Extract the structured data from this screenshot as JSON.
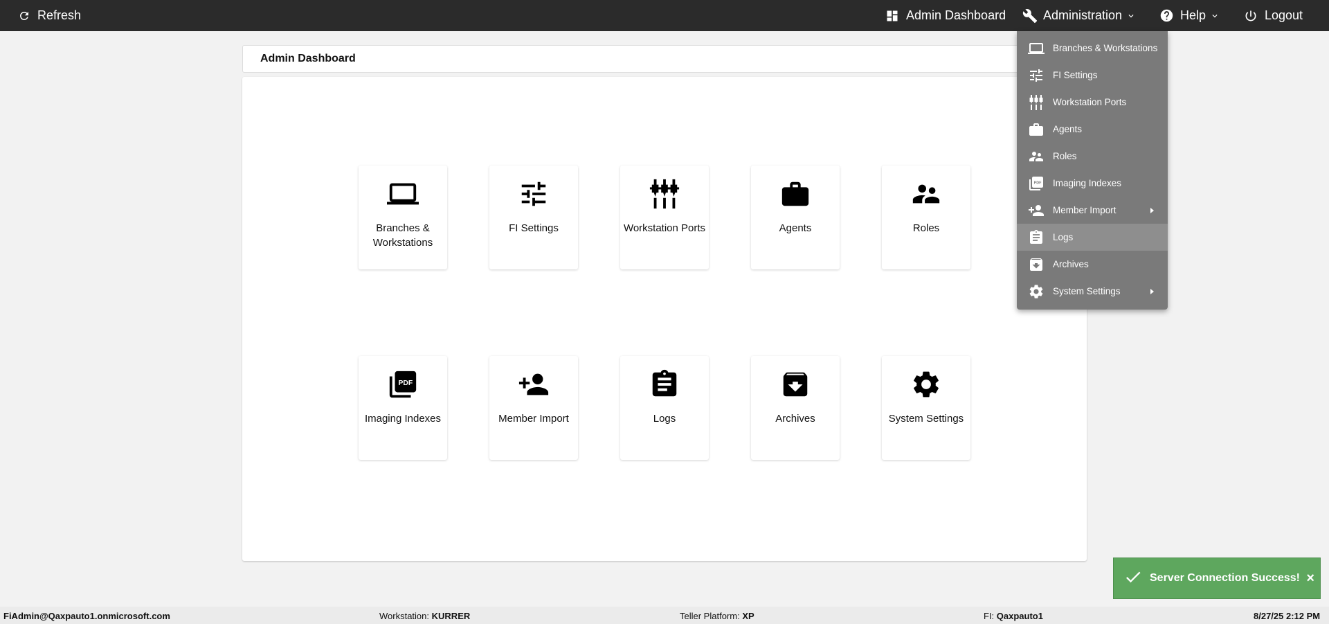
{
  "topbar": {
    "refresh_label": "Refresh",
    "admin_dashboard_label": "Admin Dashboard",
    "administration_label": "Administration",
    "help_label": "Help",
    "logout_label": "Logout"
  },
  "page": {
    "title": "Admin Dashboard"
  },
  "tiles": [
    {
      "label": "Branches & Workstations",
      "icon": "laptop-icon"
    },
    {
      "label": "FI Settings",
      "icon": "sliders-icon"
    },
    {
      "label": "Workstation Ports",
      "icon": "ports-icon"
    },
    {
      "label": "Agents",
      "icon": "briefcase-icon"
    },
    {
      "label": "Roles",
      "icon": "people-icon"
    },
    {
      "label": "Imaging Indexes",
      "icon": "pdf-icon"
    },
    {
      "label": "Member Import",
      "icon": "person-add-icon"
    },
    {
      "label": "Logs",
      "icon": "clipboard-icon"
    },
    {
      "label": "Archives",
      "icon": "archive-icon"
    },
    {
      "label": "System Settings",
      "icon": "gear-icon"
    }
  ],
  "administration_menu": {
    "items": [
      {
        "label": "Branches & Workstations",
        "icon": "laptop-icon"
      },
      {
        "label": "FI Settings",
        "icon": "sliders-icon"
      },
      {
        "label": "Workstation Ports",
        "icon": "ports-icon"
      },
      {
        "label": "Agents",
        "icon": "briefcase-icon"
      },
      {
        "label": "Roles",
        "icon": "people-icon"
      },
      {
        "label": "Imaging Indexes",
        "icon": "pdf-icon"
      },
      {
        "label": "Member Import",
        "icon": "person-add-icon",
        "has_submenu": true
      },
      {
        "label": "Logs",
        "icon": "clipboard-icon",
        "active": true
      },
      {
        "label": "Archives",
        "icon": "archive-icon"
      },
      {
        "label": "System Settings",
        "icon": "gear-icon",
        "has_submenu": true
      }
    ]
  },
  "toast": {
    "message": "Server Connection Success!",
    "close": "×"
  },
  "status": {
    "user": "FiAdmin@Qaxpauto1.onmicrosoft.com",
    "workstation_label": "Workstation:",
    "workstation_value": "KURRER",
    "platform_label": "Teller Platform:",
    "platform_value": "XP",
    "fi_label": "FI:",
    "fi_value": "Qaxpauto1",
    "datetime": "8/27/25 2:12 PM"
  },
  "colors": {
    "topbar": "#2b2b2b",
    "menu_bg": "#7a7a7a",
    "toast_bg": "#5ea75e"
  }
}
